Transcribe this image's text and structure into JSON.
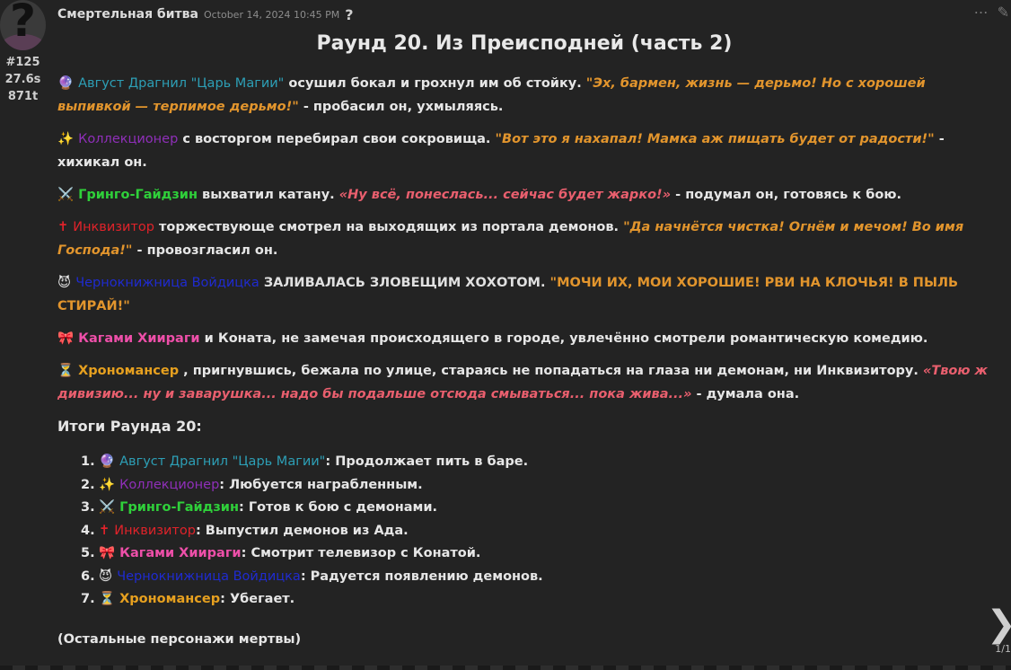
{
  "post": {
    "author": "Смертельная битва",
    "date": "October 14, 2024 10:45 PM",
    "help": "?",
    "stats": [
      "#125",
      "27.6s",
      "871t"
    ],
    "title": "Раунд 20. Из Преисподней (часть 2)"
  },
  "characters": {
    "avgust": {
      "emoji": "🔮",
      "name": "Август Драгнил \"Царь Магии\"",
      "color": "#2d9fb6"
    },
    "collector": {
      "emoji": "✨",
      "name": "Коллекционер",
      "color": "#8f2fb9"
    },
    "gringo": {
      "emoji": "⚔️",
      "name": "Гринго-Гайдзин",
      "color": "#2fd03a"
    },
    "inquisitor": {
      "emoji": "✝",
      "name": "Инквизитор",
      "color": "#e0232a"
    },
    "warlock": {
      "emoji": "😈",
      "name": "Чернокнижница Войдицка",
      "color": "#1f2bd0"
    },
    "kagami": {
      "emoji": "🎀",
      "name": "Кагами Хиираги",
      "color": "#ee4fa9"
    },
    "chrono": {
      "emoji": "⏳",
      "name": "Хрономансер",
      "color": "#e6a01f"
    }
  },
  "paragraphs": {
    "p1": {
      "action": " осушил бокал и грохнул им об стойку. ",
      "quote": "\"Эх, бармен, жизнь — дерьмо! Но с хорошей выпивкой — терпимое дерьмо!\"",
      "tail": " - пробасил он, ухмыляясь."
    },
    "p2": {
      "action": " с восторгом перебирал свои сокровища. ",
      "quote": "\"Вот это я нахапал! Мамка аж пищать будет от радости!\"",
      "tail": " - хихикал он."
    },
    "p3": {
      "action": " выхватил катану. ",
      "quote": "«Ну всё, понеслась... сейчас будет жарко!»",
      "tail": " - подумал он, готовясь к бою."
    },
    "p4": {
      "action": " торжествующе смотрел на выходящих из портала демонов. ",
      "quote": "\"Да начнётся чистка! Огнём и мечом! Во имя Господа!\"",
      "tail": " - провозгласил он."
    },
    "p5": {
      "action": " ЗАЛИВАЛАСЬ ЗЛОВЕЩИМ ХОХОТОМ. ",
      "quote": "\"МОЧИ ИХ, МОИ ХОРОШИЕ! РВИ НА КЛОЧЬЯ! В ПЫЛЬ СТИРАЙ!\""
    },
    "p6": {
      "action": " и Коната, не замечая происходящего в городе, увлечённо смотрели романтическую комедию."
    },
    "p7": {
      "action": " , пригнувшись, бежала по улице, стараясь не попадаться на глаза ни демонам, ни Инквизитору. ",
      "quote": "«Твою ж дивизию... ну и заварушка... надо бы подальше отсюда смываться... пока жива...»",
      "tail": " - думала она."
    }
  },
  "summary": {
    "title": "Итоги Раунда 20:",
    "items": [
      {
        "num": "1.",
        "text": ": Продолжает пить в баре."
      },
      {
        "num": "2.",
        "text": ": Любуется награбленным."
      },
      {
        "num": "3.",
        "text": ": Готов к бою с демонами."
      },
      {
        "num": "4.",
        "text": ": Выпустил демонов из Ада."
      },
      {
        "num": "5.",
        "text": ": Смотрит телевизор с Конатой."
      },
      {
        "num": "6.",
        "text": ": Радуется появлению демонов."
      },
      {
        "num": "7.",
        "text": ": Убегает."
      }
    ],
    "footer": "(Остальные персонажи мертвы)"
  },
  "nav": {
    "pager": "1/1",
    "more_icon": "⋯",
    "edit_icon": "✎",
    "next_icon": "❯"
  }
}
